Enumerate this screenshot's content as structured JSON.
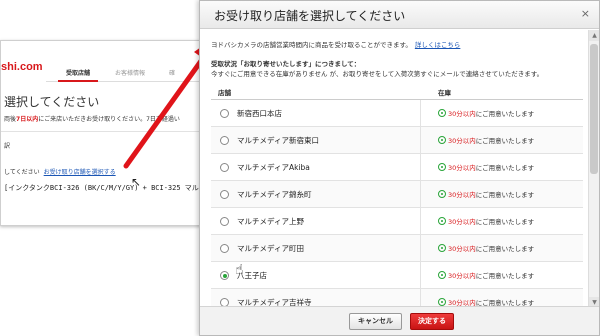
{
  "background_page": {
    "logo": "shi.com",
    "tabs": [
      "受取店舗",
      "お客様情報",
      "確"
    ],
    "heading": "選択してください",
    "note_prefix": "両後",
    "note_highlight": "7日以内",
    "note_suffix": "にご来店いただきお受け取りください。7日を経過い",
    "label": "訳",
    "row_prefix": "してください",
    "row_link": "お受け取り店舗を選択する",
    "product": "[インクタンクBCI-326 (BK/C/M/Y/GY) + BCI-325 マルチパ"
  },
  "dialog": {
    "title": "お受け取り店舗を選択してください",
    "close_icon": "×",
    "intro": "ヨドバシカメラの店舗営業時間内に商品を受け取ることができます。",
    "intro_link": "詳しくはこちら",
    "status_title": "受取状況「お取り寄せいたします」につきまして：",
    "status_body": "今すぐにご用意できる在庫がありません が、お取り寄せをして入荷次第すぐにメールで連絡させていただきます。",
    "column_store": "店舗",
    "column_stock": "在庫",
    "stock_time": "30分以内",
    "stock_rest": "にご用意いたします",
    "stores": [
      {
        "name": "新宿西口本店",
        "checked": false
      },
      {
        "name": "マルチメディア新宿東口",
        "checked": false
      },
      {
        "name": "マルチメディアAkiba",
        "checked": false
      },
      {
        "name": "マルチメディア錦糸町",
        "checked": false
      },
      {
        "name": "マルチメディア上野",
        "checked": false
      },
      {
        "name": "マルチメディア町田",
        "checked": false
      },
      {
        "name": "八王子店",
        "checked": true
      },
      {
        "name": "マルチメディア吉祥寺",
        "checked": false
      }
    ],
    "cancel_label": "キャンセル",
    "confirm_label": "決定する"
  },
  "colors": {
    "accent_red": "#d8181b",
    "link_blue": "#1a55b4",
    "stock_green": "#2aa53a"
  }
}
